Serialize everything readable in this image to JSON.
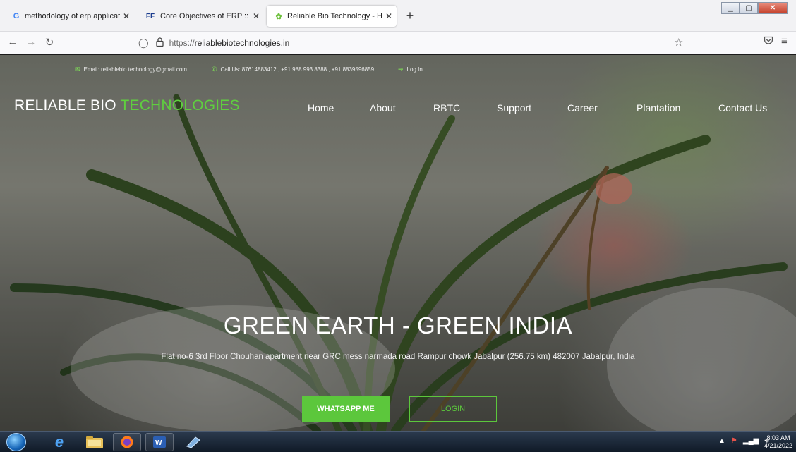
{
  "browser": {
    "tabs": [
      {
        "icon": "G",
        "icon_color": "#4285f4",
        "title": "methodology of erp application"
      },
      {
        "icon": "FF",
        "icon_color": "#1b3d8f",
        "title": "Core Objectives of ERP :: ERP In"
      },
      {
        "icon": "✿",
        "icon_color": "#6cbf3a",
        "title": "Reliable Bio Technology - Home"
      }
    ],
    "new_tab": "+",
    "url_protocol": "https://",
    "url_host": "reliablebiotechnologies.in"
  },
  "site": {
    "email_text": "Email: reliablebio.technology@gmail.com",
    "call_text": "Call Us: 87614883412 , +91 988 993 8388 , +91 8839596859",
    "login_text": "Log In",
    "brand_white": "RELIABLE BIO ",
    "brand_green": "TECHNOLOGIES",
    "nav": [
      "Home",
      "About",
      "RBTC",
      "Support",
      "Career",
      "Plantation",
      "Contact Us"
    ],
    "hero_title": "GREEN EARTH - GREEN INDIA",
    "hero_address": "Flat no-6 3rd Floor Chouhan apartment near GRC mess narmada road Rampur chowk Jabalpur (256.75 km) 482007 Jabalpur, India",
    "whatsapp_button": "WHATSAPP ME",
    "login_button": "LOGIN",
    "accent_color": "#5cc73c"
  },
  "taskbar": {
    "time": "8:03 AM",
    "date": "4/21/2022"
  }
}
